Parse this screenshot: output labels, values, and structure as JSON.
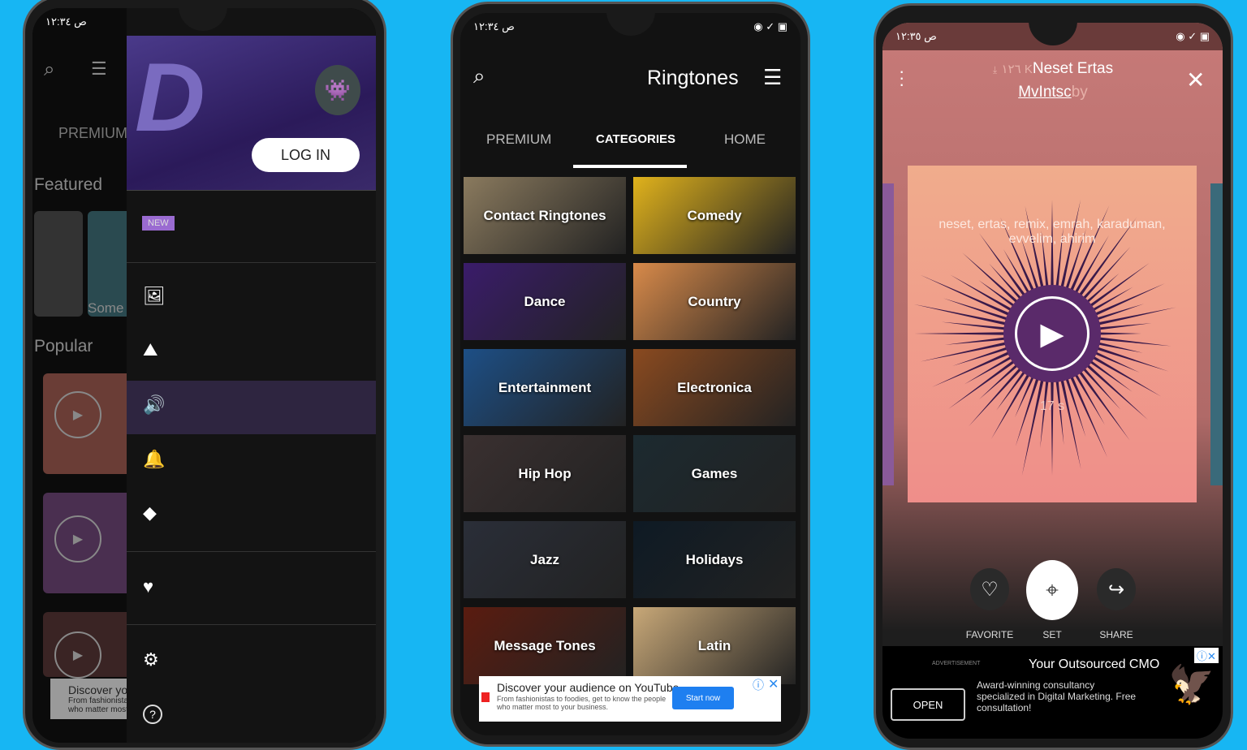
{
  "colors": {
    "background": "#17b6f3",
    "drawer_accent": "#3a2a5a",
    "player_bg": "#c77a78",
    "new_badge": "#9a6bd1"
  },
  "phone1": {
    "status_time": "ص ١٢:٣٤",
    "header": {
      "search_icon": "search-icon",
      "sort_icon": "sort-icon"
    },
    "tab_premium": "PREMIUM",
    "featured": "Featured",
    "featured_item": "Some",
    "popular": "Popular",
    "drawer": {
      "login": "LOG IN",
      "new_badge": "NEW",
      "items": [
        {
          "icon": "wallpaper-icon"
        },
        {
          "icon": "live-wallpaper-icon"
        },
        {
          "icon": "ringtone-icon",
          "active": true
        },
        {
          "icon": "notification-bell-icon"
        },
        {
          "icon": "premium-diamond-icon"
        },
        {
          "icon": "favorite-heart-icon"
        },
        {
          "icon": "settings-gear-icon"
        },
        {
          "icon": "help-icon"
        }
      ]
    },
    "ad": {
      "title": "Discover yo",
      "line1": "From fashionistas",
      "line2": "who matter most"
    }
  },
  "phone2": {
    "status_time": "ص ١٢:٣٤",
    "title": "Ringtones",
    "tabs": [
      {
        "label": "PREMIUM"
      },
      {
        "label": "CATEGORIES",
        "active": true
      },
      {
        "label": "HOME"
      }
    ],
    "categories": [
      {
        "label": "Contact Ringtones",
        "color": "#8a7a5e"
      },
      {
        "label": "Comedy",
        "color": "#e0b21c"
      },
      {
        "label": "Dance",
        "color": "#3a1c6a"
      },
      {
        "label": "Country",
        "color": "#d88a4a"
      },
      {
        "label": "Entertainment",
        "color": "#1d4f86"
      },
      {
        "label": "Electronica",
        "color": "#8a4a20"
      },
      {
        "label": "Hip Hop",
        "color": "#3a3030"
      },
      {
        "label": "Games",
        "color": "#1c2a30"
      },
      {
        "label": "Jazz",
        "color": "#2a2e38"
      },
      {
        "label": "Holidays",
        "color": "#0e1a24"
      },
      {
        "label": "Message Tones",
        "color": "#5a1c10"
      },
      {
        "label": "Latin",
        "color": "#c8a878"
      }
    ],
    "ad": {
      "title": "Discover your audience on YouTube",
      "body": "From fashionistas to foodies, get to know the people who matter most to your business.",
      "cta": "Start now"
    }
  },
  "phone3": {
    "status_time": "ص ١٢:٣٥",
    "downloads": "١٢٦ K",
    "song_title": "Neset Ertas",
    "author": "MvIntsc",
    "author_prefix": "by",
    "tags": "neset, ertas, remix, emrah, karaduman, evvelim, ahirim",
    "duration": "17 s",
    "actions": [
      {
        "label": "FAVORITE",
        "icon": "heart-outline-icon"
      },
      {
        "label": "SET",
        "icon": "set-ringtone-icon"
      },
      {
        "label": "SHARE",
        "icon": "share-arrow-icon"
      }
    ],
    "ad": {
      "tag": "ADVERTISEMENT",
      "title": "Your Outsourced CMO",
      "body": "Award-winning consultancy specialized in Digital Marketing. Free consultation!",
      "cta": "OPEN"
    }
  }
}
